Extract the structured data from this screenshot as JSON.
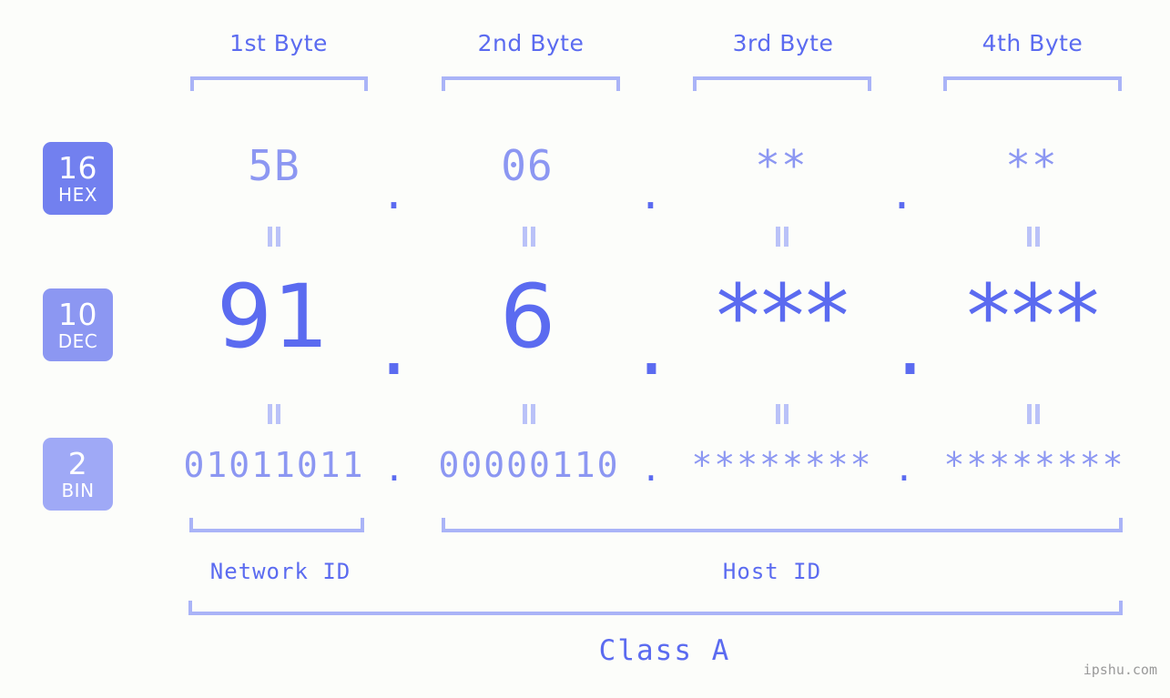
{
  "page": {
    "background_color": "#fcfdfa",
    "accent_strong": "#5b6bf0",
    "accent_mid": "#8c97f2",
    "accent_light": "#aab4f7",
    "watermark": "ipshu.com"
  },
  "byte_headers": [
    {
      "label": "1st Byte"
    },
    {
      "label": "2nd Byte"
    },
    {
      "label": "3rd Byte"
    },
    {
      "label": "4th Byte"
    }
  ],
  "bases": [
    {
      "number": "16",
      "name": "HEX",
      "color": "#7280ef"
    },
    {
      "number": "10",
      "name": "DEC",
      "color": "#8c97f2"
    },
    {
      "number": "2",
      "name": "BIN",
      "color": "#9fa9f6"
    }
  ],
  "rows": {
    "hex": {
      "base_number": "16",
      "base_name": "HEX",
      "values": [
        "5B",
        "06",
        "**",
        "**"
      ],
      "separators": [
        ".",
        ".",
        "."
      ]
    },
    "dec": {
      "base_number": "10",
      "base_name": "DEC",
      "values": [
        "91",
        "6",
        "***",
        "***"
      ],
      "separators": [
        ".",
        ".",
        "."
      ]
    },
    "bin": {
      "base_number": "2",
      "base_name": "BIN",
      "values": [
        "01011011",
        "00000110",
        "********",
        "********"
      ],
      "separators": [
        ".",
        ".",
        "."
      ]
    }
  },
  "equality_marks": {
    "symbol": "=",
    "hex_to_dec_count": 4,
    "dec_to_bin_count": 4
  },
  "sections": [
    {
      "label": "Network ID"
    },
    {
      "label": "Host ID"
    }
  ],
  "class": {
    "label": "Class A"
  }
}
